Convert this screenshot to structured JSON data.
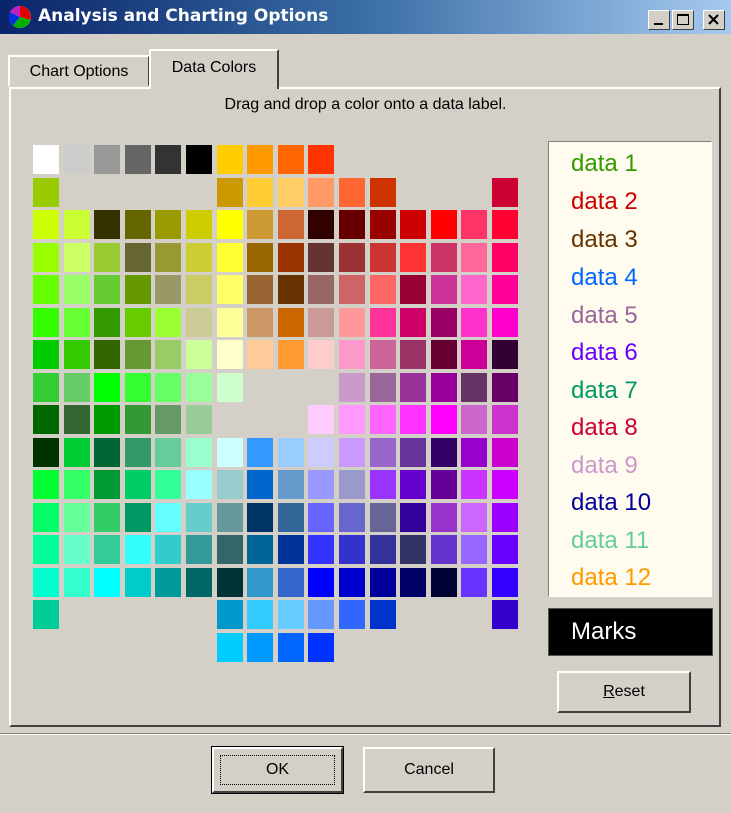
{
  "window": {
    "title": "Analysis and Charting Options"
  },
  "tabs": [
    {
      "label": "Chart Options",
      "active": false
    },
    {
      "label": "Data Colors",
      "active": true
    }
  ],
  "instruction": "Drag and drop a color onto a data label.",
  "legend": [
    {
      "label": "data 1",
      "color": "#339900"
    },
    {
      "label": "data 2",
      "color": "#cc0000"
    },
    {
      "label": "data 3",
      "color": "#663300"
    },
    {
      "label": "data 4",
      "color": "#0066ff"
    },
    {
      "label": "data 5",
      "color": "#996699"
    },
    {
      "label": "data 6",
      "color": "#6600ff"
    },
    {
      "label": "data 7",
      "color": "#009966"
    },
    {
      "label": "data 8",
      "color": "#cc0033"
    },
    {
      "label": "data 9",
      "color": "#cc99cc"
    },
    {
      "label": "data 10",
      "color": "#000099"
    },
    {
      "label": "data 11",
      "color": "#66cc99"
    },
    {
      "label": "data 12",
      "color": "#ff9900"
    }
  ],
  "marks": {
    "label": "Marks",
    "background": "#000000",
    "color": "#ffffff"
  },
  "buttons": {
    "reset": {
      "mnemonic": "R",
      "rest": "eset"
    },
    "ok": "OK",
    "cancel": "Cancel"
  },
  "palette": [
    [
      [
        0,
        "#ffffff"
      ],
      [
        1,
        "#cccccc"
      ],
      [
        2,
        "#999999"
      ],
      [
        3,
        "#666666"
      ],
      [
        4,
        "#333333"
      ],
      [
        5,
        "#000000"
      ],
      [
        6,
        "#ffcc00"
      ],
      [
        7,
        "#ff9900"
      ],
      [
        8,
        "#ff6600"
      ],
      [
        9,
        "#ff3300"
      ]
    ],
    [
      [
        0,
        "#99cc00"
      ],
      [
        6,
        "#cc9900"
      ],
      [
        7,
        "#ffcc33"
      ],
      [
        8,
        "#ffcc66"
      ],
      [
        9,
        "#ff9966"
      ],
      [
        10,
        "#ff6633"
      ],
      [
        11,
        "#cc3300"
      ],
      [
        15,
        "#cc0033"
      ]
    ],
    [
      [
        0,
        "#ccff00"
      ],
      [
        1,
        "#ccff33"
      ],
      [
        2,
        "#333300"
      ],
      [
        3,
        "#666600"
      ],
      [
        4,
        "#999900"
      ],
      [
        5,
        "#cccc00"
      ],
      [
        6,
        "#ffff00"
      ],
      [
        7,
        "#cc9933"
      ],
      [
        8,
        "#cc6633"
      ],
      [
        9,
        "#330000"
      ],
      [
        10,
        "#660000"
      ],
      [
        11,
        "#990000"
      ],
      [
        12,
        "#cc0000"
      ],
      [
        13,
        "#ff0000"
      ],
      [
        14,
        "#ff3366"
      ],
      [
        15,
        "#ff0033"
      ]
    ],
    [
      [
        0,
        "#99ff00"
      ],
      [
        1,
        "#ccff66"
      ],
      [
        2,
        "#99cc33"
      ],
      [
        3,
        "#666633"
      ],
      [
        4,
        "#999933"
      ],
      [
        5,
        "#cccc33"
      ],
      [
        6,
        "#ffff33"
      ],
      [
        7,
        "#996600"
      ],
      [
        8,
        "#993300"
      ],
      [
        9,
        "#663333"
      ],
      [
        10,
        "#993333"
      ],
      [
        11,
        "#cc3333"
      ],
      [
        12,
        "#ff3333"
      ],
      [
        13,
        "#cc3366"
      ],
      [
        14,
        "#ff6699"
      ],
      [
        15,
        "#ff0066"
      ]
    ],
    [
      [
        0,
        "#66ff00"
      ],
      [
        1,
        "#99ff66"
      ],
      [
        2,
        "#66cc33"
      ],
      [
        3,
        "#669900"
      ],
      [
        4,
        "#999966"
      ],
      [
        5,
        "#cccc66"
      ],
      [
        6,
        "#ffff66"
      ],
      [
        7,
        "#996633"
      ],
      [
        8,
        "#663300"
      ],
      [
        9,
        "#996666"
      ],
      [
        10,
        "#cc6666"
      ],
      [
        11,
        "#ff6666"
      ],
      [
        12,
        "#990033"
      ],
      [
        13,
        "#cc3399"
      ],
      [
        14,
        "#ff66cc"
      ],
      [
        15,
        "#ff0099"
      ]
    ],
    [
      [
        0,
        "#33ff00"
      ],
      [
        1,
        "#66ff33"
      ],
      [
        2,
        "#339900"
      ],
      [
        3,
        "#66cc00"
      ],
      [
        4,
        "#99ff33"
      ],
      [
        5,
        "#cccc99"
      ],
      [
        6,
        "#ffff99"
      ],
      [
        7,
        "#cc9966"
      ],
      [
        8,
        "#cc6600"
      ],
      [
        9,
        "#cc9999"
      ],
      [
        10,
        "#ff9999"
      ],
      [
        11,
        "#ff3399"
      ],
      [
        12,
        "#cc0066"
      ],
      [
        13,
        "#990066"
      ],
      [
        14,
        "#ff33cc"
      ],
      [
        15,
        "#ff00cc"
      ]
    ],
    [
      [
        0,
        "#00cc00"
      ],
      [
        1,
        "#33cc00"
      ],
      [
        2,
        "#336600"
      ],
      [
        3,
        "#669933"
      ],
      [
        4,
        "#99cc66"
      ],
      [
        5,
        "#ccff99"
      ],
      [
        6,
        "#ffffcc"
      ],
      [
        7,
        "#ffcc99"
      ],
      [
        8,
        "#ff9933"
      ],
      [
        9,
        "#ffcccc"
      ],
      [
        10,
        "#ff99cc"
      ],
      [
        11,
        "#cc6699"
      ],
      [
        12,
        "#993366"
      ],
      [
        13,
        "#660033"
      ],
      [
        14,
        "#cc0099"
      ],
      [
        15,
        "#330033"
      ]
    ],
    [
      [
        0,
        "#33cc33"
      ],
      [
        1,
        "#66cc66"
      ],
      [
        2,
        "#00ff00"
      ],
      [
        3,
        "#33ff33"
      ],
      [
        4,
        "#66ff66"
      ],
      [
        5,
        "#99ff99"
      ],
      [
        6,
        "#ccffcc"
      ],
      [
        10,
        "#cc99cc"
      ],
      [
        11,
        "#996699"
      ],
      [
        12,
        "#993399"
      ],
      [
        13,
        "#990099"
      ],
      [
        14,
        "#663366"
      ],
      [
        15,
        "#660066"
      ]
    ],
    [
      [
        0,
        "#006600"
      ],
      [
        1,
        "#336633"
      ],
      [
        2,
        "#009900"
      ],
      [
        3,
        "#339933"
      ],
      [
        4,
        "#669966"
      ],
      [
        5,
        "#99cc99"
      ],
      [
        9,
        "#ffccff"
      ],
      [
        10,
        "#ff99ff"
      ],
      [
        11,
        "#ff66ff"
      ],
      [
        12,
        "#ff33ff"
      ],
      [
        13,
        "#ff00ff"
      ],
      [
        14,
        "#cc66cc"
      ],
      [
        15,
        "#cc33cc"
      ]
    ],
    [
      [
        0,
        "#003300"
      ],
      [
        1,
        "#00cc33"
      ],
      [
        2,
        "#006633"
      ],
      [
        3,
        "#339966"
      ],
      [
        4,
        "#66cc99"
      ],
      [
        5,
        "#99ffcc"
      ],
      [
        6,
        "#ccffff"
      ],
      [
        7,
        "#3399ff"
      ],
      [
        8,
        "#99ccff"
      ],
      [
        9,
        "#ccccff"
      ],
      [
        10,
        "#cc99ff"
      ],
      [
        11,
        "#9966cc"
      ],
      [
        12,
        "#663399"
      ],
      [
        13,
        "#330066"
      ],
      [
        14,
        "#9900cc"
      ],
      [
        15,
        "#cc00cc"
      ]
    ],
    [
      [
        0,
        "#00ff33"
      ],
      [
        1,
        "#33ff66"
      ],
      [
        2,
        "#009933"
      ],
      [
        3,
        "#00cc66"
      ],
      [
        4,
        "#33ff99"
      ],
      [
        5,
        "#99ffff"
      ],
      [
        6,
        "#99cccc"
      ],
      [
        7,
        "#0066cc"
      ],
      [
        8,
        "#6699cc"
      ],
      [
        9,
        "#9999ff"
      ],
      [
        10,
        "#9999cc"
      ],
      [
        11,
        "#9933ff"
      ],
      [
        12,
        "#6600cc"
      ],
      [
        13,
        "#660099"
      ],
      [
        14,
        "#cc33ff"
      ],
      [
        15,
        "#cc00ff"
      ]
    ],
    [
      [
        0,
        "#00ff66"
      ],
      [
        1,
        "#66ff99"
      ],
      [
        2,
        "#33cc66"
      ],
      [
        3,
        "#009966"
      ],
      [
        4,
        "#66ffff"
      ],
      [
        5,
        "#66cccc"
      ],
      [
        6,
        "#669999"
      ],
      [
        7,
        "#003366"
      ],
      [
        8,
        "#336699"
      ],
      [
        9,
        "#6666ff"
      ],
      [
        10,
        "#6666cc"
      ],
      [
        11,
        "#666699"
      ],
      [
        12,
        "#330099"
      ],
      [
        13,
        "#9933cc"
      ],
      [
        14,
        "#cc66ff"
      ],
      [
        15,
        "#9900ff"
      ]
    ],
    [
      [
        0,
        "#00ff99"
      ],
      [
        1,
        "#66ffcc"
      ],
      [
        2,
        "#33cc99"
      ],
      [
        3,
        "#33ffff"
      ],
      [
        4,
        "#33cccc"
      ],
      [
        5,
        "#339999"
      ],
      [
        6,
        "#336666"
      ],
      [
        7,
        "#006699"
      ],
      [
        8,
        "#003399"
      ],
      [
        9,
        "#3333ff"
      ],
      [
        10,
        "#3333cc"
      ],
      [
        11,
        "#333399"
      ],
      [
        12,
        "#333366"
      ],
      [
        13,
        "#6633cc"
      ],
      [
        14,
        "#9966ff"
      ],
      [
        15,
        "#6600ff"
      ]
    ],
    [
      [
        0,
        "#00ffcc"
      ],
      [
        1,
        "#33ffcc"
      ],
      [
        2,
        "#00ffff"
      ],
      [
        3,
        "#00cccc"
      ],
      [
        4,
        "#009999"
      ],
      [
        5,
        "#006666"
      ],
      [
        6,
        "#003333"
      ],
      [
        7,
        "#3399cc"
      ],
      [
        8,
        "#3366cc"
      ],
      [
        9,
        "#0000ff"
      ],
      [
        10,
        "#0000cc"
      ],
      [
        11,
        "#000099"
      ],
      [
        12,
        "#000066"
      ],
      [
        13,
        "#000033"
      ],
      [
        14,
        "#6633ff"
      ],
      [
        15,
        "#3300ff"
      ]
    ],
    [
      [
        0,
        "#00cc99"
      ],
      [
        6,
        "#0099cc"
      ],
      [
        7,
        "#33ccff"
      ],
      [
        8,
        "#66ccff"
      ],
      [
        9,
        "#6699ff"
      ],
      [
        10,
        "#3366ff"
      ],
      [
        11,
        "#0033cc"
      ],
      [
        15,
        "#3300cc"
      ]
    ],
    [
      [
        6,
        "#00ccff"
      ],
      [
        7,
        "#0099ff"
      ],
      [
        8,
        "#0066ff"
      ],
      [
        9,
        "#0033ff"
      ]
    ]
  ]
}
